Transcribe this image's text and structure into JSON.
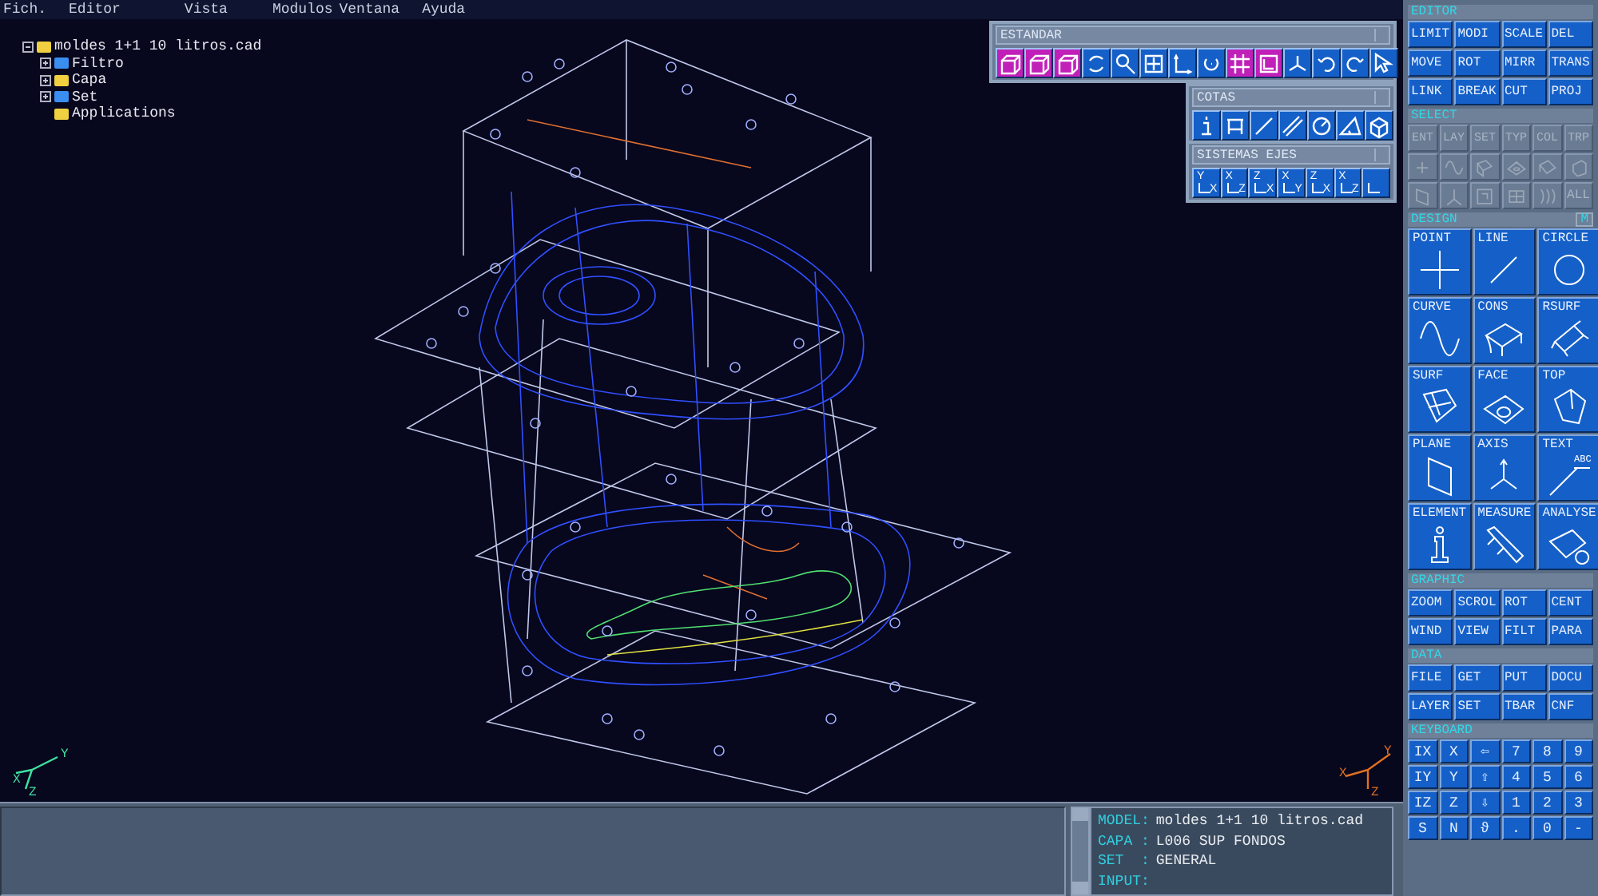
{
  "menu": [
    "Fich.",
    "Editor",
    "Vista",
    "Modulos",
    "Ventana",
    "Ayuda"
  ],
  "tree": {
    "label": "moldes 1+1 10 litros.cad",
    "color": "#f0d040",
    "expanded": true,
    "children": [
      {
        "label": "Filtro",
        "color": "#3a8ef0",
        "expanded": false
      },
      {
        "label": "Capa",
        "color": "#f0d040",
        "expanded": false
      },
      {
        "label": "Set",
        "color": "#3a8ef0",
        "expanded": false
      },
      {
        "label": "Applications",
        "color": "#f0d040"
      }
    ]
  },
  "toolbars": [
    {
      "title": "ESTANDAR",
      "buttons": [
        {
          "active": true
        },
        {
          "active": true
        },
        {
          "active": true
        },
        {
          "active": false
        },
        {
          "active": false
        },
        {
          "active": false
        },
        {
          "active": false
        },
        {
          "active": false
        },
        {
          "active": true
        },
        {
          "active": true
        },
        {
          "active": false
        },
        {
          "active": false
        },
        {
          "active": false
        },
        {
          "active": false
        }
      ]
    },
    {
      "title": "COTAS",
      "buttons": [
        {
          "active": false
        },
        {
          "active": false
        },
        {
          "active": false
        },
        {
          "active": false
        },
        {
          "active": false
        },
        {
          "active": false
        },
        {
          "active": false
        }
      ]
    },
    {
      "title": "SISTEMAS EJES",
      "buttons": [
        {
          "active": false,
          "labels": [
            "Y",
            "X"
          ]
        },
        {
          "active": false,
          "labels": [
            "X",
            "Z"
          ]
        },
        {
          "active": false,
          "labels": [
            "Z",
            "X"
          ]
        },
        {
          "active": false,
          "labels": [
            "X",
            "Y"
          ]
        },
        {
          "active": false,
          "labels": [
            "Z",
            "X"
          ]
        },
        {
          "active": false,
          "labels": [
            "X",
            "Z"
          ]
        },
        {
          "active": false
        }
      ]
    }
  ],
  "triads": [
    {
      "x": "X",
      "y": "Y",
      "z": "Z",
      "color": "#40e0a0"
    },
    {
      "x": "X",
      "y": "Y",
      "z": "Z",
      "color": "#e07020"
    }
  ],
  "editor": {
    "title": "EDITOR",
    "buttons": [
      "LIMIT",
      "MODI",
      "SCALE",
      "DEL",
      "MOVE",
      "ROT",
      "MIRR",
      "TRANS",
      "LINK",
      "BREAK",
      "CUT",
      "PROJ"
    ]
  },
  "select": {
    "title": "SELECT",
    "buttons": [
      {
        "label": "ENT",
        "disabled": true
      },
      {
        "label": "LAY",
        "disabled": true
      },
      {
        "label": "SET",
        "disabled": true
      },
      {
        "label": "TYP",
        "disabled": true
      },
      {
        "label": "COL",
        "disabled": true
      },
      {
        "label": "TRP",
        "disabled": true
      }
    ],
    "tools": [
      {
        "disabled": true
      },
      {
        "disabled": true
      },
      {
        "disabled": true
      },
      {
        "disabled": true
      },
      {
        "disabled": true
      },
      {
        "disabled": true
      },
      {
        "disabled": true
      },
      {
        "disabled": true
      },
      {
        "disabled": true
      },
      {
        "disabled": true
      },
      {
        "disabled": true
      },
      {
        "label": "ALL",
        "disabled": true
      }
    ]
  },
  "design": {
    "title": "DESIGN",
    "mode_button": "M",
    "tools": [
      {
        "label": "POINT"
      },
      {
        "label": "LINE"
      },
      {
        "label": "CIRCLE"
      },
      {
        "label": "CURVE"
      },
      {
        "label": "CONS"
      },
      {
        "label": "RSURF"
      },
      {
        "label": "SURF"
      },
      {
        "label": "FACE"
      },
      {
        "label": "TOP"
      },
      {
        "label": "PLANE"
      },
      {
        "label": "AXIS"
      },
      {
        "label": "TEXT",
        "icon_text": "ABC"
      },
      {
        "label": "ELEMENT"
      },
      {
        "label": "MEASURE"
      },
      {
        "label": "ANALYSE"
      }
    ]
  },
  "graphic": {
    "title": "GRAPHIC",
    "buttons": [
      "ZOOM",
      "SCROL",
      "ROT",
      "CENT",
      "WIND",
      "VIEW",
      "FILT",
      "PARA"
    ]
  },
  "data": {
    "title": "DATA",
    "buttons": [
      "FILE",
      "GET",
      "PUT",
      "DOCU",
      "LAYER",
      "SET",
      "TBAR",
      "CNF"
    ]
  },
  "keyboard": {
    "title": "KEYBOARD",
    "keys": [
      "IX",
      "X",
      "⇦",
      "7",
      "8",
      "9",
      "IY",
      "Y",
      "⇧",
      "4",
      "5",
      "6",
      "IZ",
      "Z",
      "⇩",
      "1",
      "2",
      "3",
      "S",
      "N",
      "ϑ",
      ".",
      "0",
      "-"
    ]
  },
  "status": [
    {
      "label": "MODEL:",
      "value": "moldes 1+1 10 litros.cad"
    },
    {
      "label": "CAPA :",
      "value": "L006 SUP FONDOS"
    },
    {
      "label": "SET  :",
      "value": "GENERAL"
    },
    {
      "label": "INPUT:"
    }
  ]
}
